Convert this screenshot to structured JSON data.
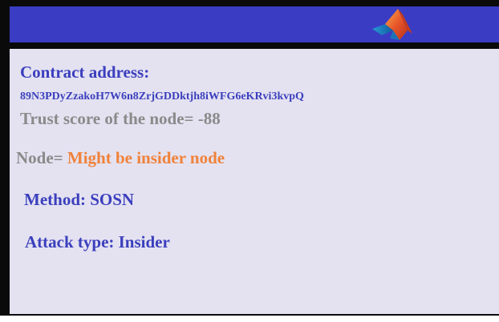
{
  "header": {
    "logo_icon": "matlab-membrane-logo-icon",
    "bar_color": "#3a3cc4"
  },
  "panel": {
    "contract_label": "Contract address:",
    "contract_value": "89N3PDyZzakoH7W6n8ZrjGDDktjh8iWFG6eKRvi3kvpQ",
    "trust_line": "Trust score of the node= -88",
    "node_prefix": "Node= ",
    "node_status": "Might be insider node",
    "method_line": "Method: SOSN",
    "attack_line": "Attack type: Insider"
  },
  "colors": {
    "accent_blue": "#3b3fbd",
    "muted_gray": "#8a8a8a",
    "warning_orange": "#f0823a",
    "panel_bg": "#e4e2f1"
  }
}
